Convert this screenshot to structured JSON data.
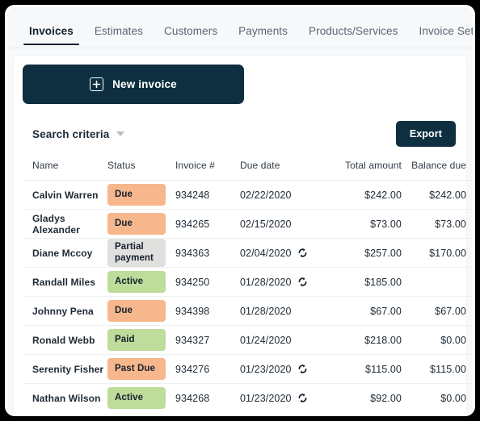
{
  "tabs": [
    {
      "label": "Invoices",
      "active": true
    },
    {
      "label": "Estimates",
      "active": false
    },
    {
      "label": "Customers",
      "active": false
    },
    {
      "label": "Payments",
      "active": false
    },
    {
      "label": "Products/Services",
      "active": false
    },
    {
      "label": "Invoice Settings",
      "active": false
    }
  ],
  "actions": {
    "new_invoice_label": "New invoice",
    "new_invoice_icon": "plus-square-icon",
    "export_label": "Export"
  },
  "toolbar": {
    "search_criteria_label": "Search criteria",
    "chevron_icon": "chevron-down-icon"
  },
  "table": {
    "columns": [
      "Name",
      "Status",
      "Invoice #",
      "Due date",
      "Total amount",
      "Balance due"
    ],
    "rows": [
      {
        "name": "Calvin Warren",
        "status": "Due",
        "status_color": "#f6b78d",
        "invoice": "934248",
        "due_date": "02/22/2020",
        "recurring": false,
        "total": "$242.00",
        "balance": "$242.00"
      },
      {
        "name": "Gladys Alexander",
        "status": "Due",
        "status_color": "#f6b78d",
        "invoice": "934265",
        "due_date": "02/15/2020",
        "recurring": false,
        "total": "$73.00",
        "balance": "$73.00"
      },
      {
        "name": "Diane Mccoy",
        "status": "Partial payment",
        "status_color": "#e0e0de",
        "invoice": "934363",
        "due_date": "02/04/2020",
        "recurring": true,
        "total": "$257.00",
        "balance": "$170.00"
      },
      {
        "name": "Randall Miles",
        "status": "Active",
        "status_color": "#bedc9a",
        "invoice": "934250",
        "due_date": "01/28/2020",
        "recurring": true,
        "total": "$185.00",
        "balance": ""
      },
      {
        "name": "Johnny Pena",
        "status": "Due",
        "status_color": "#f6b78d",
        "invoice": "934398",
        "due_date": "01/28/2020",
        "recurring": false,
        "total": "$67.00",
        "balance": "$67.00"
      },
      {
        "name": "Ronald Webb",
        "status": "Paid",
        "status_color": "#bedc9a",
        "invoice": "934327",
        "due_date": "01/24/2020",
        "recurring": false,
        "total": "$218.00",
        "balance": "$0.00"
      },
      {
        "name": "Serenity Fisher",
        "status": "Past Due",
        "status_color": "#f6b78d",
        "invoice": "934276",
        "due_date": "01/23/2020",
        "recurring": true,
        "total": "$115.00",
        "balance": "$115.00"
      },
      {
        "name": "Nathan Wilson",
        "status": "Active",
        "status_color": "#bedc9a",
        "invoice": "934268",
        "due_date": "01/23/2020",
        "recurring": true,
        "total": "$92.00",
        "balance": "$0.00"
      }
    ],
    "recurring_icon": "recurring-refresh-icon"
  },
  "colors": {
    "brand_dark": "#0e2f3f",
    "status_due": "#f6b78d",
    "status_active": "#bedc9a",
    "status_partial": "#e0e0de",
    "page_bg": "#f7f8fa"
  }
}
